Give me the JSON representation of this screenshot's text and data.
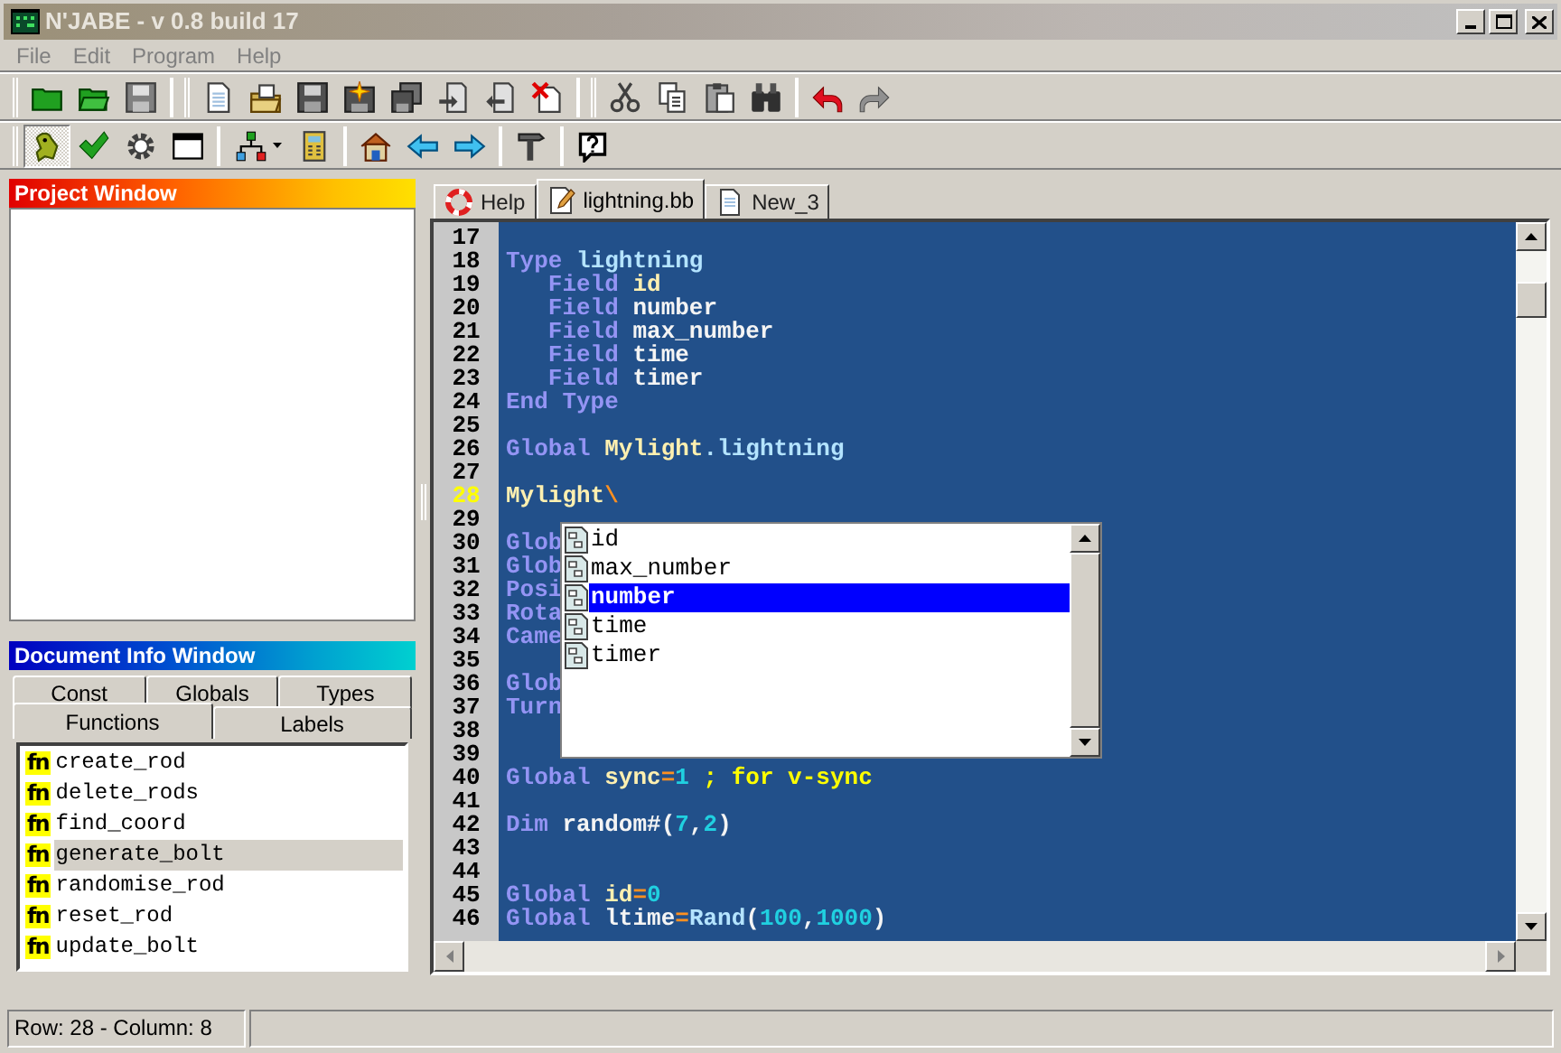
{
  "window": {
    "title": "N'JABE - v 0.8 build 17"
  },
  "menu": [
    "File",
    "Edit",
    "Program",
    "Help"
  ],
  "toolbars": [
    [
      [
        {
          "pressed": false
        },
        {
          "pressed": false
        },
        {
          "pressed": false
        }
      ],
      [
        {
          "pressed": false
        },
        {
          "pressed": false
        },
        {
          "pressed": false
        },
        {
          "pressed": false
        },
        {
          "pressed": false
        },
        {
          "pressed": false
        },
        {
          "pressed": false
        },
        {
          "pressed": false
        }
      ],
      [
        {
          "pressed": false
        },
        {
          "pressed": false
        },
        {
          "pressed": false
        },
        {
          "pressed": false
        }
      ],
      [
        {
          "pressed": false
        },
        {
          "pressed": false
        }
      ]
    ],
    [
      [
        {
          "pressed": true
        },
        {
          "pressed": false
        },
        {
          "pressed": false
        },
        {
          "pressed": false
        }
      ],
      [
        {
          "pressed": false
        },
        {
          "pressed": false
        }
      ],
      [
        {
          "pressed": false
        },
        {
          "pressed": false
        },
        {
          "pressed": false
        }
      ],
      [
        {
          "pressed": false
        }
      ],
      [
        {
          "pressed": false
        }
      ]
    ]
  ],
  "project_window": {
    "title": "Project Window"
  },
  "document_info": {
    "title": "Document Info Window",
    "tab_rows": [
      [
        {
          "label": "Const",
          "selected": false
        },
        {
          "label": "Globals",
          "selected": false
        },
        {
          "label": "Types",
          "selected": false
        }
      ],
      [
        {
          "label": "Functions",
          "selected": true
        },
        {
          "label": "Labels",
          "selected": false
        }
      ]
    ],
    "functions": [
      {
        "icon": "fn",
        "name": "create_rod",
        "selected": false
      },
      {
        "icon": "fn",
        "name": "delete_rods",
        "selected": false
      },
      {
        "icon": "fn",
        "name": "find_coord",
        "selected": false
      },
      {
        "icon": "fn",
        "name": "generate_bolt",
        "selected": true
      },
      {
        "icon": "fn",
        "name": "randomise_rod",
        "selected": false
      },
      {
        "icon": "fn",
        "name": "reset_rod",
        "selected": false
      },
      {
        "icon": "fn",
        "name": "update_bolt",
        "selected": false
      }
    ]
  },
  "editor": {
    "tabs": [
      {
        "label": "Help",
        "selected": false
      },
      {
        "label": "lightning.bb",
        "selected": true
      },
      {
        "label": "New_3",
        "selected": false
      }
    ],
    "lines": [
      {
        "number": "17",
        "current": false
      },
      {
        "number": "18",
        "current": false,
        "tokens": [
          {
            "kind": "kw",
            "t": "Type"
          },
          {
            "kind": "type",
            "t": " lightning"
          }
        ]
      },
      {
        "number": "19",
        "current": false,
        "tokens": [
          {
            "kind": "kw",
            "t": "   Field"
          },
          {
            "kind": "var",
            "t": " id"
          }
        ]
      },
      {
        "number": "20",
        "current": false,
        "tokens": [
          {
            "kind": "kw",
            "t": "   Field"
          },
          {
            "kind": "ident",
            "t": " number"
          }
        ]
      },
      {
        "number": "21",
        "current": false,
        "tokens": [
          {
            "kind": "kw",
            "t": "   Field"
          },
          {
            "kind": "ident",
            "t": " max_number"
          }
        ]
      },
      {
        "number": "22",
        "current": false,
        "tokens": [
          {
            "kind": "kw",
            "t": "   Field"
          },
          {
            "kind": "ident",
            "t": " time"
          }
        ]
      },
      {
        "number": "23",
        "current": false,
        "tokens": [
          {
            "kind": "kw",
            "t": "   Field"
          },
          {
            "kind": "ident",
            "t": " timer"
          }
        ]
      },
      {
        "number": "24",
        "current": false,
        "tokens": [
          {
            "kind": "kw",
            "t": "End Type"
          }
        ]
      },
      {
        "number": "25",
        "current": false
      },
      {
        "number": "26",
        "current": false,
        "tokens": [
          {
            "kind": "kw",
            "t": "Global"
          },
          {
            "kind": "var",
            "t": " Mylight"
          },
          {
            "kind": "type",
            "t": ".lightning"
          }
        ]
      },
      {
        "number": "27",
        "current": false
      },
      {
        "number": "28",
        "current": true,
        "tokens": [
          {
            "kind": "var",
            "t": "Mylight"
          },
          {
            "kind": "op",
            "t": "\\"
          }
        ]
      },
      {
        "number": "29",
        "current": false
      },
      {
        "number": "30",
        "current": false,
        "tokens": [
          {
            "kind": "kw",
            "t": "Glob"
          }
        ]
      },
      {
        "number": "31",
        "current": false,
        "tokens": [
          {
            "kind": "kw",
            "t": "Glob"
          }
        ]
      },
      {
        "number": "32",
        "current": false,
        "tokens": [
          {
            "kind": "kw",
            "t": "Posi"
          }
        ]
      },
      {
        "number": "33",
        "current": false,
        "tokens": [
          {
            "kind": "kw",
            "t": "Rota"
          }
        ]
      },
      {
        "number": "34",
        "current": false,
        "tokens": [
          {
            "kind": "kw",
            "t": "Came"
          }
        ]
      },
      {
        "number": "35",
        "current": false
      },
      {
        "number": "36",
        "current": false,
        "tokens": [
          {
            "kind": "kw",
            "t": "Glob"
          }
        ]
      },
      {
        "number": "37",
        "current": false,
        "tokens": [
          {
            "kind": "kw",
            "t": "Turn"
          }
        ]
      },
      {
        "number": "38",
        "current": false
      },
      {
        "number": "39",
        "current": false
      },
      {
        "number": "40",
        "current": false,
        "tokens": [
          {
            "kind": "kw",
            "t": "Global"
          },
          {
            "kind": "var",
            "t": " sync"
          },
          {
            "kind": "op",
            "t": "="
          },
          {
            "kind": "num",
            "t": "1"
          },
          {
            "kind": "comment",
            "t": " ; for v-sync"
          }
        ]
      },
      {
        "number": "41",
        "current": false
      },
      {
        "number": "42",
        "current": false,
        "tokens": [
          {
            "kind": "kw",
            "t": "Dim"
          },
          {
            "kind": "ident",
            "t": " random#("
          },
          {
            "kind": "num",
            "t": "7"
          },
          {
            "kind": "ident",
            "t": ","
          },
          {
            "kind": "num",
            "t": "2"
          },
          {
            "kind": "ident",
            "t": ")"
          }
        ]
      },
      {
        "number": "43",
        "current": false
      },
      {
        "number": "44",
        "current": false
      },
      {
        "number": "45",
        "current": false,
        "tokens": [
          {
            "kind": "kw",
            "t": "Global"
          },
          {
            "kind": "var",
            "t": " id"
          },
          {
            "kind": "op",
            "t": "="
          },
          {
            "kind": "num",
            "t": "0"
          }
        ]
      },
      {
        "number": "46",
        "current": false,
        "tokens": [
          {
            "kind": "kw",
            "t": "Global"
          },
          {
            "kind": "ident",
            "t": " ltime"
          },
          {
            "kind": "op",
            "t": "="
          },
          {
            "kind": "type",
            "t": "Rand"
          },
          {
            "kind": "ident",
            "t": "("
          },
          {
            "kind": "num",
            "t": "100"
          },
          {
            "kind": "ident",
            "t": ","
          },
          {
            "kind": "num",
            "t": "1000"
          },
          {
            "kind": "ident",
            "t": ")"
          }
        ]
      }
    ],
    "autocomplete": [
      {
        "label": "id",
        "selected": false
      },
      {
        "label": "max_number",
        "selected": false
      },
      {
        "label": "number",
        "selected": true
      },
      {
        "label": "time",
        "selected": false
      },
      {
        "label": "timer",
        "selected": false
      }
    ]
  },
  "status_bar": {
    "position": "Row: 28 - Column: 8"
  }
}
